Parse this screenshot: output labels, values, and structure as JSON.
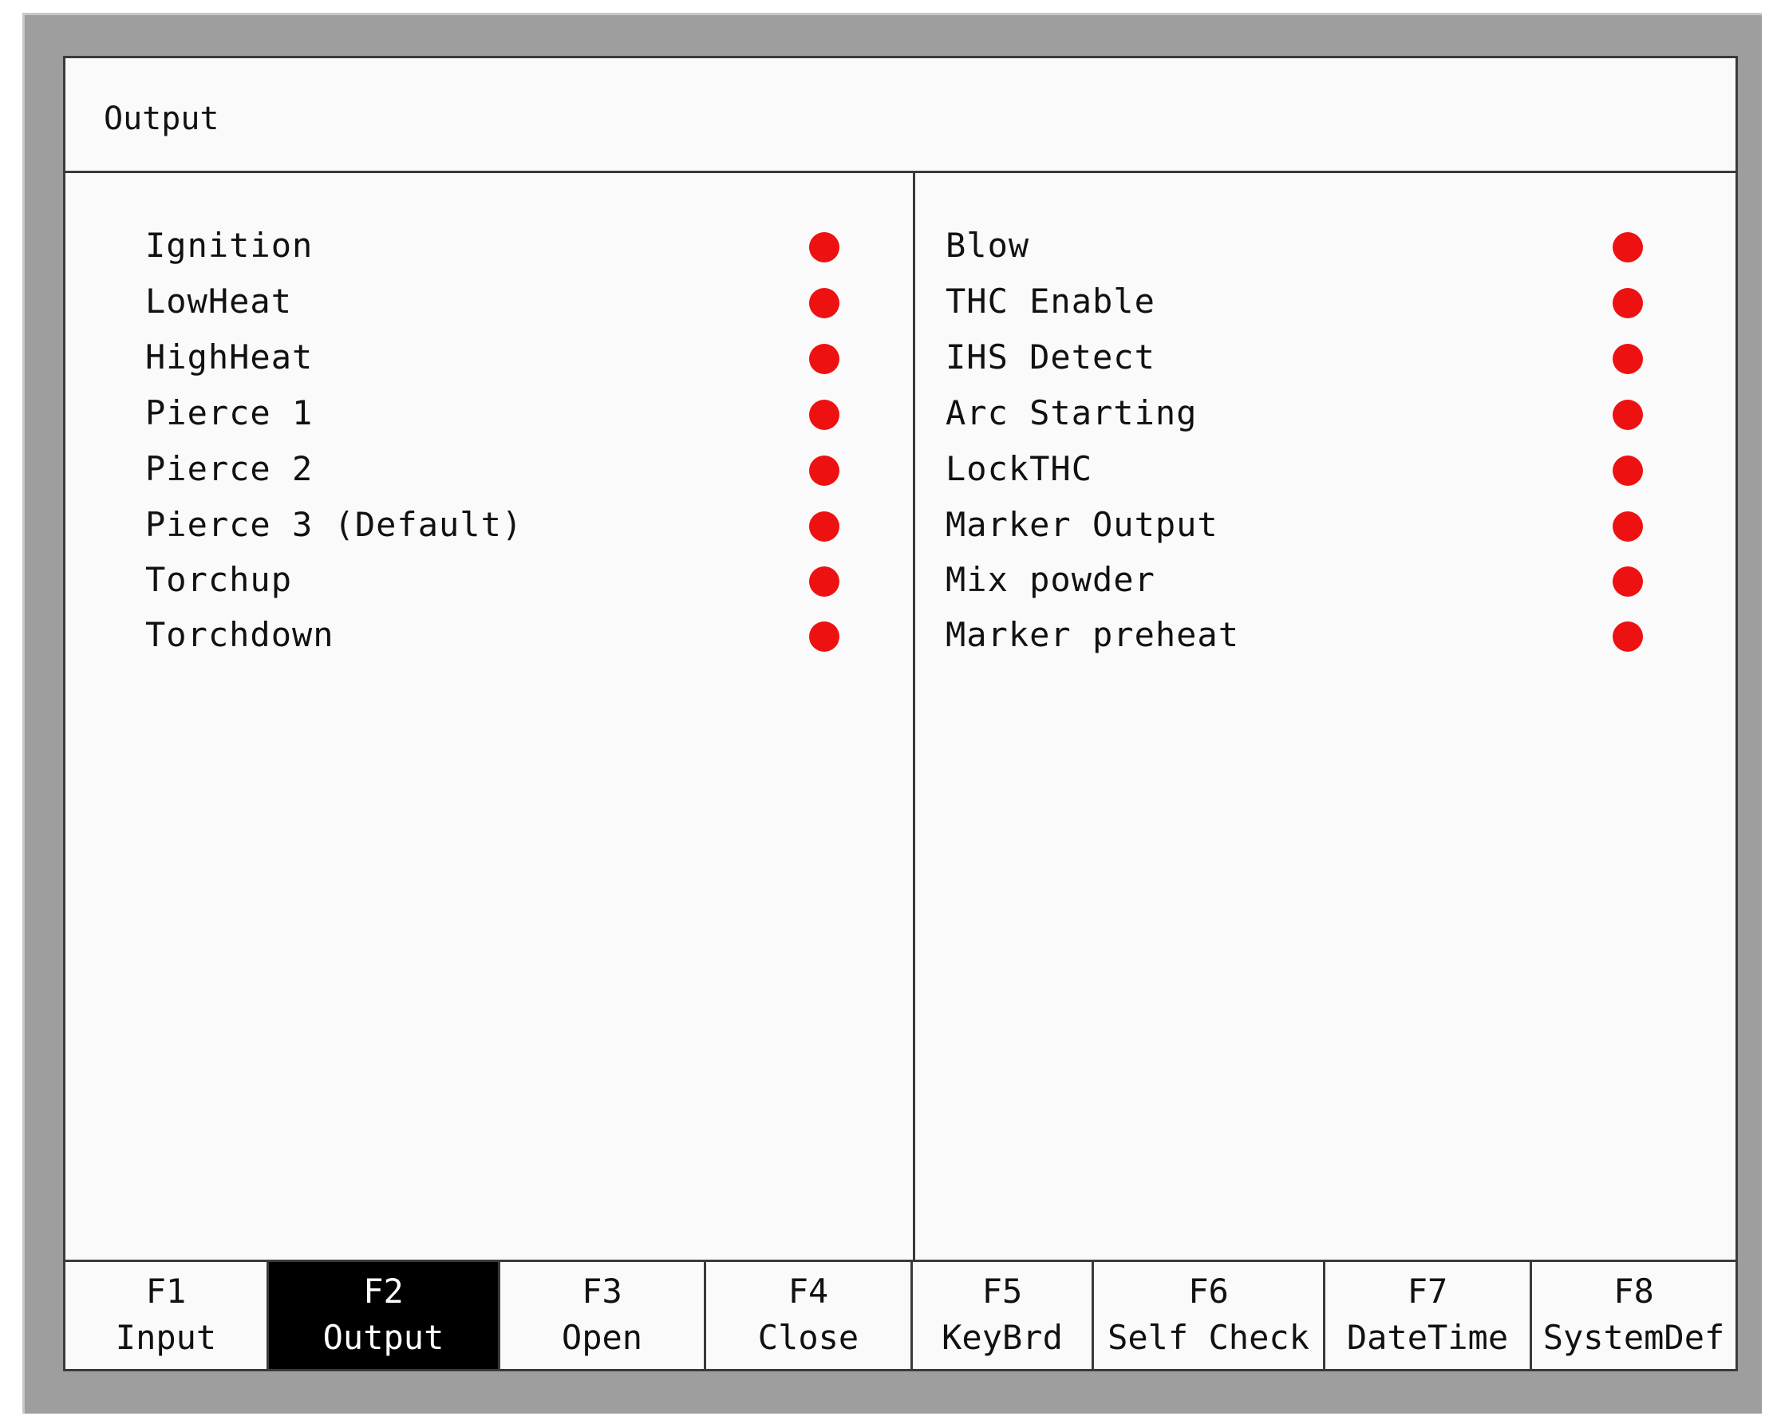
{
  "screen": {
    "title": "Output"
  },
  "outputs_left": [
    {
      "label": "Ignition",
      "status_color": "#ee1111"
    },
    {
      "label": "LowHeat",
      "status_color": "#ee1111"
    },
    {
      "label": "HighHeat",
      "status_color": "#ee1111"
    },
    {
      "label": "Pierce 1",
      "status_color": "#ee1111"
    },
    {
      "label": "Pierce 2",
      "status_color": "#ee1111"
    },
    {
      "label": "Pierce 3 (Default)",
      "status_color": "#ee1111"
    },
    {
      "label": "Torchup",
      "status_color": "#ee1111"
    },
    {
      "label": "Torchdown",
      "status_color": "#ee1111"
    }
  ],
  "outputs_right": [
    {
      "label": "Blow",
      "status_color": "#ee1111"
    },
    {
      "label": "THC Enable",
      "status_color": "#ee1111"
    },
    {
      "label": "IHS Detect",
      "status_color": "#ee1111"
    },
    {
      "label": "Arc Starting",
      "status_color": "#ee1111"
    },
    {
      "label": "LockTHC",
      "status_color": "#ee1111"
    },
    {
      "label": "Marker Output",
      "status_color": "#ee1111"
    },
    {
      "label": "Mix powder",
      "status_color": "#ee1111"
    },
    {
      "label": "Marker preheat",
      "status_color": "#ee1111"
    }
  ],
  "function_keys": [
    {
      "key": "F1",
      "label": "Input",
      "active": false
    },
    {
      "key": "F2",
      "label": "Output",
      "active": true
    },
    {
      "key": "F3",
      "label": "Open",
      "active": false
    },
    {
      "key": "F4",
      "label": "Close",
      "active": false
    },
    {
      "key": "F5",
      "label": "KeyBrd",
      "active": false
    },
    {
      "key": "F6",
      "label": "Self Check",
      "active": false
    },
    {
      "key": "F7",
      "label": "DateTime",
      "active": false
    },
    {
      "key": "F8",
      "label": "SystemDef",
      "active": false
    }
  ],
  "colors": {
    "indicator_off": "#ee1111",
    "active_key_bg": "#000000",
    "screen_bg": "#fafafa",
    "bezel": "#9e9e9e"
  }
}
